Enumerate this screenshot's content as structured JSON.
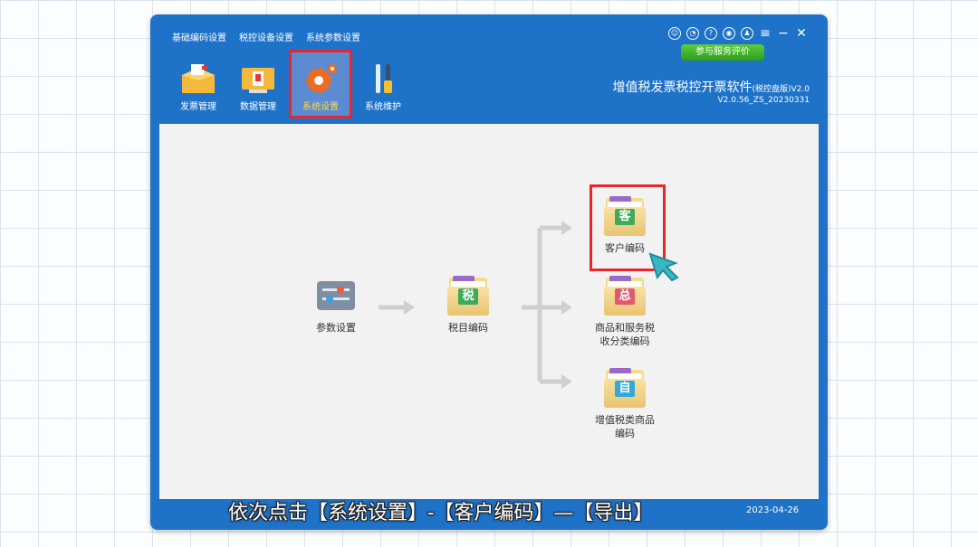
{
  "menu": [
    "基础编码设置",
    "税控设备设置",
    "系统参数设置"
  ],
  "feedback": "参与服务评价",
  "toolbar": [
    "发票管理",
    "数据管理",
    "系统设置",
    "系统维护"
  ],
  "app": {
    "title": "增值税发票税控开票软件",
    "edition": "(税控盘版)V2.0",
    "version": "V2.0.56_ZS_20230331"
  },
  "flow": {
    "param": "参数设置",
    "tax_item": "税目编码",
    "customer": "客户编码",
    "goods_line1": "商品和服务税",
    "goods_line2": "收分类编码",
    "vat_line1": "增值税类商品",
    "vat_line2": "编码"
  },
  "stamps": {
    "tax": "税",
    "customer": "客",
    "goods": "总",
    "vat": "自"
  },
  "colors": {
    "accent": "#1e72c8",
    "highlight": "#e8262b",
    "green": "#3faa5a",
    "red": "#e05a6e",
    "cyan": "#36a8d8"
  },
  "caption": "依次点击【系统设置】-【客户编码】—【导出】",
  "status_date": "2023-04-26"
}
